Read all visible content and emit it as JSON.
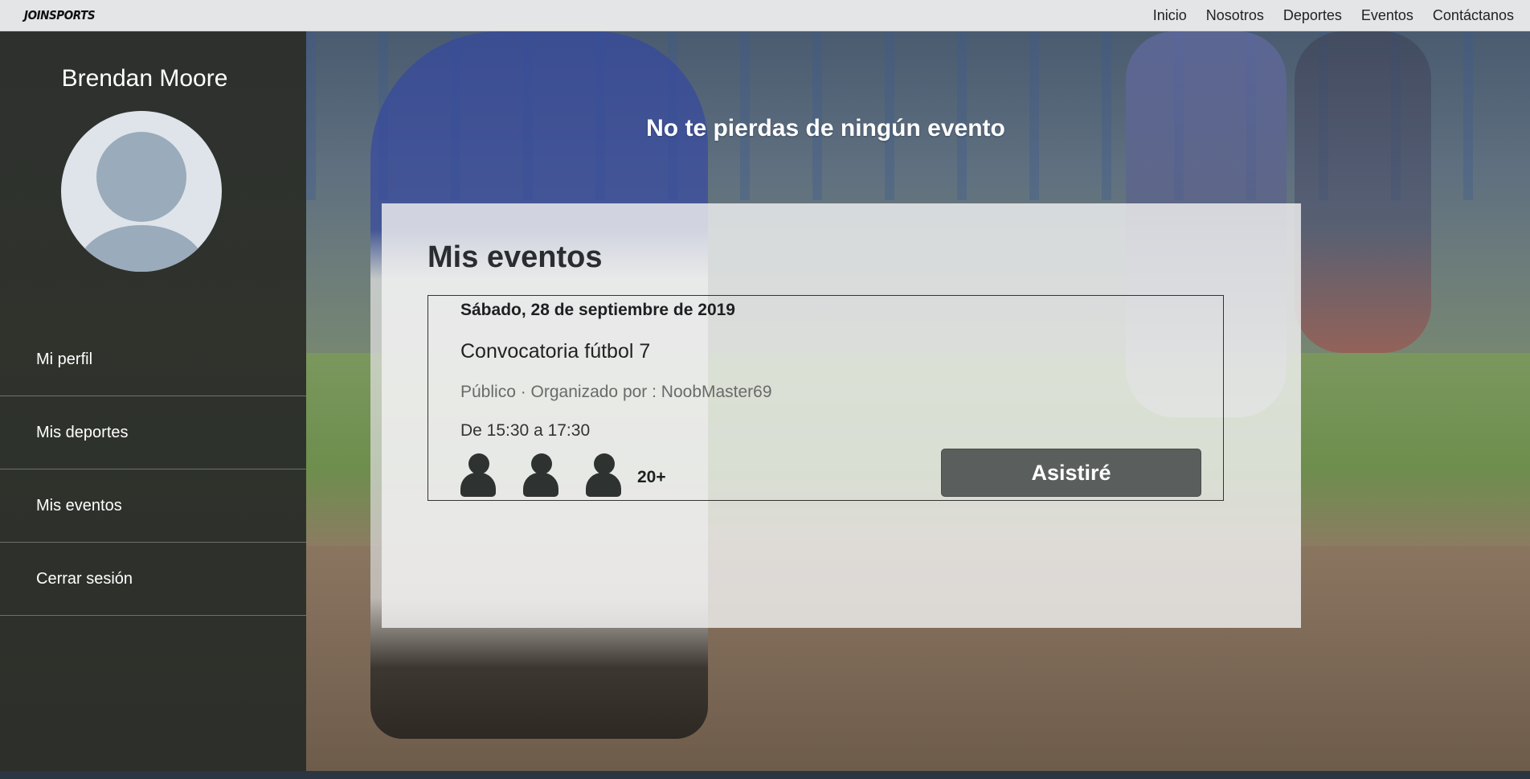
{
  "navbar": {
    "brand": "JOINSPORTS",
    "links": [
      "Inicio",
      "Nosotros",
      "Deportes",
      "Eventos",
      "Contáctanos"
    ]
  },
  "sidebar": {
    "user_name": "Brendan Moore",
    "avatar_icon": "user-avatar-icon",
    "items": [
      {
        "label": "Mi perfil"
      },
      {
        "label": "Mis deportes"
      },
      {
        "label": "Mis eventos"
      },
      {
        "label": "Cerrar sesión"
      }
    ]
  },
  "hero": {
    "title": "No te pierdas de ningún evento"
  },
  "events": {
    "title": "Mis eventos",
    "items": [
      {
        "date": "Sábado, 28 de septiembre de 2019",
        "name": "Convocatoria fútbol 7",
        "meta": "Público · Organizado por : NoobMaster69",
        "time": "De 15:30 a 17:30",
        "attendee_icon": "person-icon",
        "attendee_count": "20+",
        "button_label": "Asistiré"
      }
    ]
  },
  "colors": {
    "sidebar_bg": "#2e302e",
    "navbar_bg": "#e4e5e7",
    "button_bg": "#5a5f5e"
  }
}
